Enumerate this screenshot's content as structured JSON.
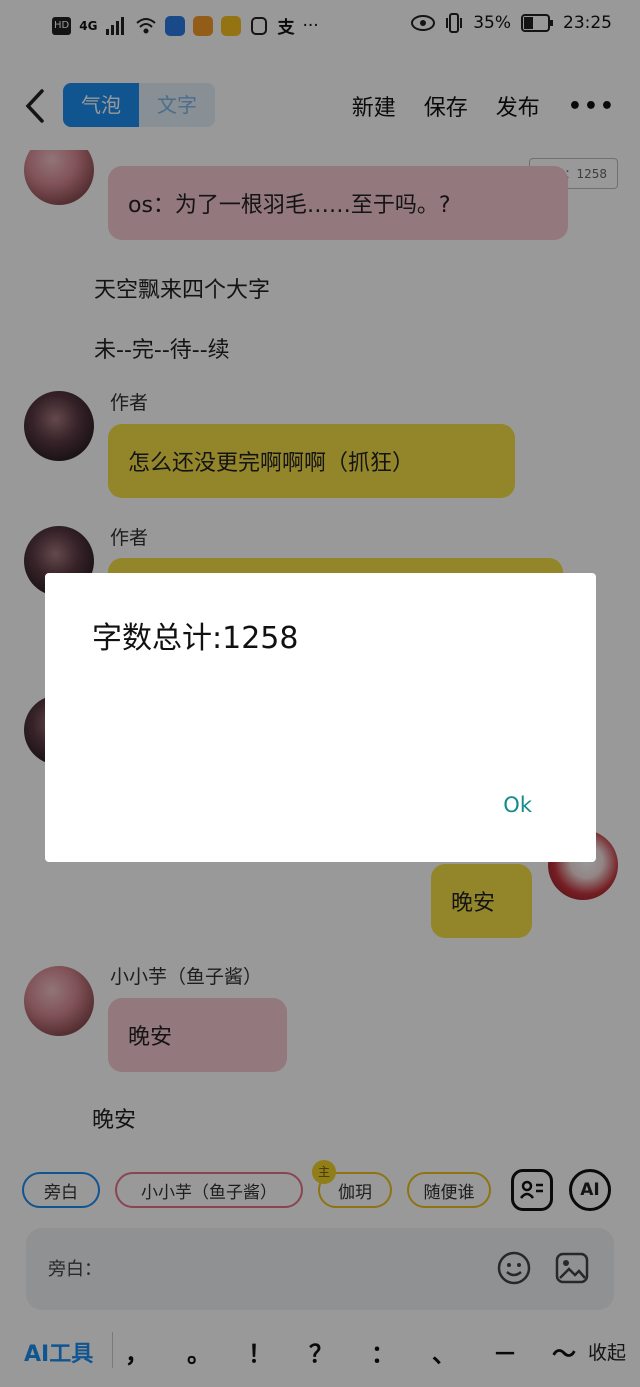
{
  "status_bar": {
    "hd": "HD",
    "network": "4G",
    "battery": "35%",
    "time": "23:25"
  },
  "header": {
    "tabs": [
      "气泡",
      "文字"
    ],
    "actions": {
      "new": "新建",
      "save": "保存",
      "publish": "发布"
    }
  },
  "chat": {
    "word_count_badge": "字数：1258",
    "messages": [
      {
        "type": "bubble",
        "text": "os：为了一根羽毛……至于吗。?"
      },
      {
        "type": "narration",
        "text": "天空飘来四个大字"
      },
      {
        "type": "narration",
        "text": "未--完--待--续"
      },
      {
        "type": "bubble",
        "speaker": "作者",
        "text": "怎么还没更完啊啊啊（抓狂）"
      },
      {
        "type": "bubble",
        "speaker": "作者",
        "text": ""
      },
      {
        "type": "bubble",
        "speaker": "",
        "text": "晚安",
        "side": "right"
      },
      {
        "type": "bubble",
        "speaker": "小小芋（鱼子酱）",
        "text": "晚安"
      },
      {
        "type": "narration",
        "text": "晚安"
      }
    ]
  },
  "roles": {
    "chips": [
      "旁白",
      "小小芋（鱼子酱）",
      "伽玥",
      "随便谁"
    ],
    "crown": "主",
    "ai_label": "AI"
  },
  "input": {
    "placeholder": "旁白："
  },
  "toolbar": {
    "ai_tools": "AI工具",
    "punctuation": [
      "，",
      "。",
      "！",
      "？",
      "：",
      "、",
      "－",
      "～"
    ],
    "collapse": "收起"
  },
  "dialog": {
    "message": "字数总计:1258",
    "ok": "Ok"
  },
  "colors": {
    "accent": "#1d8ef0",
    "pink_bubble": "#f6c8d0",
    "yellow_bubble": "#f6e046",
    "ok_text": "#148b8b"
  }
}
